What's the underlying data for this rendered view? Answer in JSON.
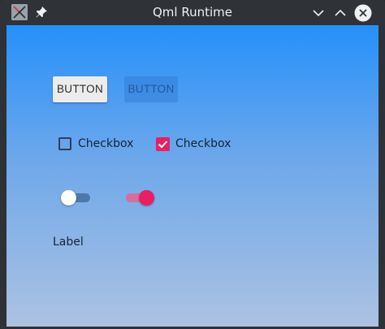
{
  "window": {
    "title": "Qml Runtime",
    "icons": {
      "app": "qml-runtime-app-icon",
      "pin": "pin-icon",
      "minimize": "chevron-down-icon",
      "maximize": "chevron-up-icon",
      "close": "close-icon"
    }
  },
  "buttons": {
    "enabled": {
      "label": "BUTTON",
      "state": "enabled"
    },
    "disabled": {
      "label": "BUTTON",
      "state": "disabled"
    }
  },
  "checkboxes": [
    {
      "label": "Checkbox",
      "checked": false
    },
    {
      "label": "Checkbox",
      "checked": true
    }
  ],
  "switches": [
    {
      "on": false
    },
    {
      "on": true
    }
  ],
  "label": {
    "text": "Label"
  },
  "colors": {
    "accent": "#e91e63",
    "gradient_top": "#2590fb",
    "gradient_bottom": "#adc2e2",
    "titlebar": "#2f3237"
  }
}
